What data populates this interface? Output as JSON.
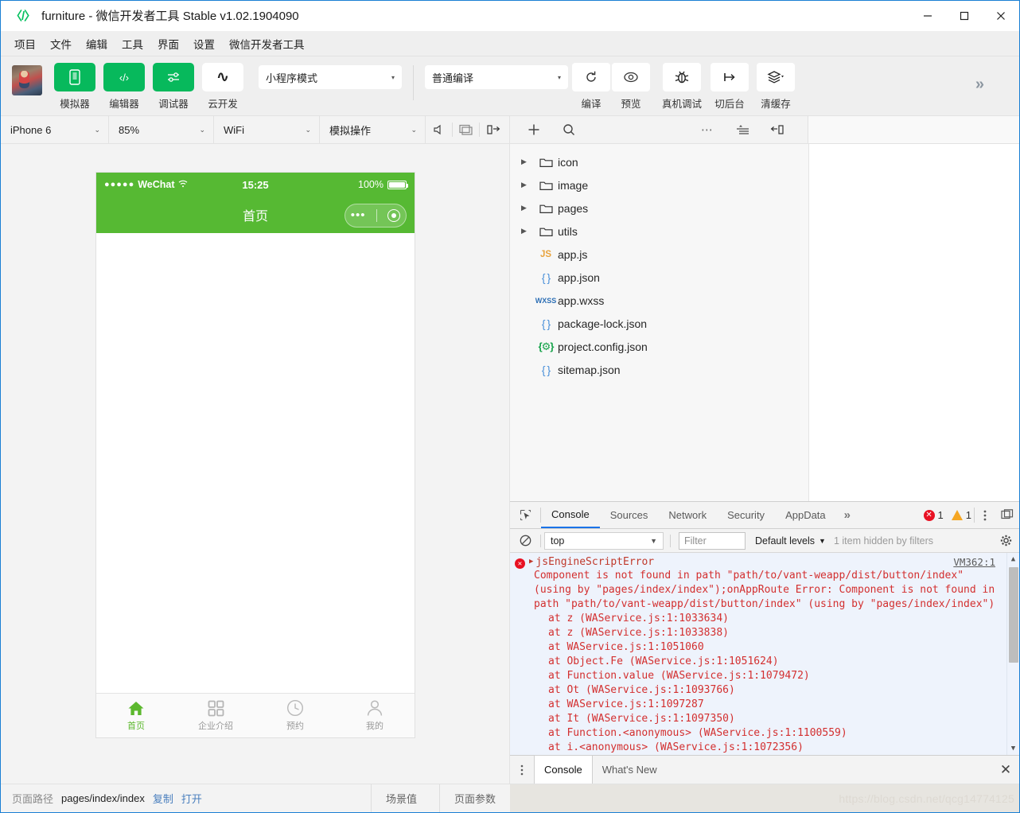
{
  "window": {
    "logo_icon": "code-brackets-icon",
    "title": "furniture - 微信开发者工具 Stable v1.02.1904090",
    "minimize": "—",
    "maximize": "▢",
    "close": "✕"
  },
  "menubar": {
    "items": [
      {
        "label": "项目"
      },
      {
        "label": "文件"
      },
      {
        "label": "编辑"
      },
      {
        "label": "工具"
      },
      {
        "label": "界面"
      },
      {
        "label": "设置"
      },
      {
        "label": "微信开发者工具"
      }
    ]
  },
  "toolbar": {
    "avatar": "user-avatar",
    "buttons": [
      {
        "label": "模拟器",
        "icon": "phone-icon",
        "glyph": "▯",
        "style": "green"
      },
      {
        "label": "编辑器",
        "icon": "code-icon",
        "glyph": "‹/›",
        "style": "green"
      },
      {
        "label": "调试器",
        "icon": "debugger-icon",
        "glyph": "⚟",
        "style": "green"
      },
      {
        "label": "云开发",
        "icon": "cloud-dev-icon",
        "glyph": "∽",
        "style": "white"
      }
    ],
    "mode_select": {
      "value": "小程序模式",
      "caret": "▾"
    },
    "compile_select": {
      "value": "普通编译",
      "caret": "▾"
    },
    "actions": [
      {
        "label": "编译",
        "icon": "refresh-icon"
      },
      {
        "label": "预览",
        "icon": "eye-icon"
      },
      {
        "label": "真机调试",
        "icon": "bug-icon"
      },
      {
        "label": "切后台",
        "icon": "background-icon"
      },
      {
        "label": "清缓存",
        "icon": "layers-icon"
      }
    ],
    "overflow": "»"
  },
  "device_bar": {
    "device": {
      "value": "iPhone 6",
      "caret": "⌄"
    },
    "zoom": {
      "value": "85%",
      "caret": "⌄"
    },
    "network": {
      "value": "WiFi",
      "caret": "⌄"
    },
    "simulate": {
      "value": "模拟操作",
      "caret": "⌄"
    },
    "icons": [
      {
        "name": "volume-icon"
      },
      {
        "name": "screen-icon"
      },
      {
        "name": "rotate-right-icon"
      }
    ]
  },
  "simulator": {
    "status_bar": {
      "carrier_dots": "●●●●●",
      "carrier": "WeChat",
      "wifi_icon": "wifi-icon",
      "time": "15:25",
      "battery_pct": "100%",
      "battery_icon": "battery-icon"
    },
    "nav_title": "首页",
    "capsule": {
      "more_icon": "more-dots-icon",
      "target_icon": "target-icon"
    },
    "tabbar": [
      {
        "label": "首页",
        "icon": "home-icon",
        "active": true
      },
      {
        "label": "企业介绍",
        "icon": "grid-icon",
        "active": false
      },
      {
        "label": "预约",
        "icon": "clock-icon",
        "active": false
      },
      {
        "label": "我的",
        "icon": "person-icon",
        "active": false
      }
    ]
  },
  "editor": {
    "toolbar_icons": [
      {
        "name": "add-file-icon",
        "glyph": "+"
      },
      {
        "name": "search-icon",
        "glyph": "⌕"
      },
      {
        "name": "more-icon",
        "glyph": "⋯"
      },
      {
        "name": "collapse-all-icon",
        "glyph": "≡"
      },
      {
        "name": "collapse-panel-icon",
        "glyph": "⇤"
      }
    ],
    "tree": [
      {
        "name": "icon",
        "type": "folder",
        "expanded": false
      },
      {
        "name": "image",
        "type": "folder",
        "expanded": false
      },
      {
        "name": "pages",
        "type": "folder",
        "expanded": false
      },
      {
        "name": "utils",
        "type": "folder",
        "expanded": false
      },
      {
        "name": "app.js",
        "type": "js",
        "badge": "JS"
      },
      {
        "name": "app.json",
        "type": "json",
        "badge": "{ }"
      },
      {
        "name": "app.wxss",
        "type": "wxss",
        "badge": "WXSS"
      },
      {
        "name": "package-lock.json",
        "type": "json",
        "badge": "{ }"
      },
      {
        "name": "project.config.json",
        "type": "config",
        "badge": "{⚙}"
      },
      {
        "name": "sitemap.json",
        "type": "json",
        "badge": "{ }"
      }
    ]
  },
  "devtools": {
    "inspect_icon": "inspect-element-icon",
    "tabs": [
      {
        "label": "Console",
        "active": true
      },
      {
        "label": "Sources",
        "active": false
      },
      {
        "label": "Network",
        "active": false
      },
      {
        "label": "Security",
        "active": false
      },
      {
        "label": "AppData",
        "active": false
      }
    ],
    "overflow": "»",
    "error_count": "1",
    "warning_count": "1",
    "kebab_icon": "kebab-menu-icon",
    "dock_icon": "dock-panel-icon",
    "filterbar": {
      "clear_icon": "clear-console-icon",
      "context": {
        "value": "top",
        "caret": "▼"
      },
      "filter_placeholder": "Filter",
      "levels": "Default levels",
      "levels_caret": "▼",
      "hidden_note": "1 item hidden by filters",
      "settings_icon": "gear-icon"
    },
    "console": {
      "error_icon": "error-circle-icon",
      "expand_triangle": "▶",
      "error_name": "jsEngineScriptError",
      "source_link": "VM362:1",
      "message": "Component is not found in path \"path/to/vant-weapp/dist/button/index\" (using by \"pages/index/index\");onAppRoute Error: Component is not found in path \"path/to/vant-weapp/dist/button/index\" (using by \"pages/index/index\")",
      "stack": [
        "at z (WAService.js:1:1033634)",
        "at z (WAService.js:1:1033838)",
        "at WAService.js:1:1051060",
        "at Object.Fe (WAService.js:1:1051624)",
        "at Function.value (WAService.js:1:1079472)",
        "at Ot (WAService.js:1:1093766)",
        "at WAService.js:1:1097287",
        "at It (WAService.js:1:1097350)",
        "at Function.<anonymous> (WAService.js:1:1100559)",
        "at i.<anonymous> (WAService.js:1:1072356)"
      ]
    },
    "drawer": {
      "kebab_icon": "kebab-menu-icon",
      "tabs": [
        {
          "label": "Console",
          "active": true
        },
        {
          "label": "What's New",
          "active": false
        }
      ],
      "close": "✕"
    }
  },
  "statusbar": {
    "path_key": "页面路径",
    "path_value": "pages/index/index",
    "copy_link": "复制",
    "open_link": "打开",
    "scene_button": "场景值",
    "params_button": "页面参数",
    "watermark": "https://blog.csdn.net/qcg14774125"
  },
  "colors": {
    "wechat_green": "#07b95c",
    "sim_green": "#56b933",
    "accent_blue": "#1a73e8",
    "error_red": "#e81123",
    "warn_orange": "#f5a623"
  }
}
